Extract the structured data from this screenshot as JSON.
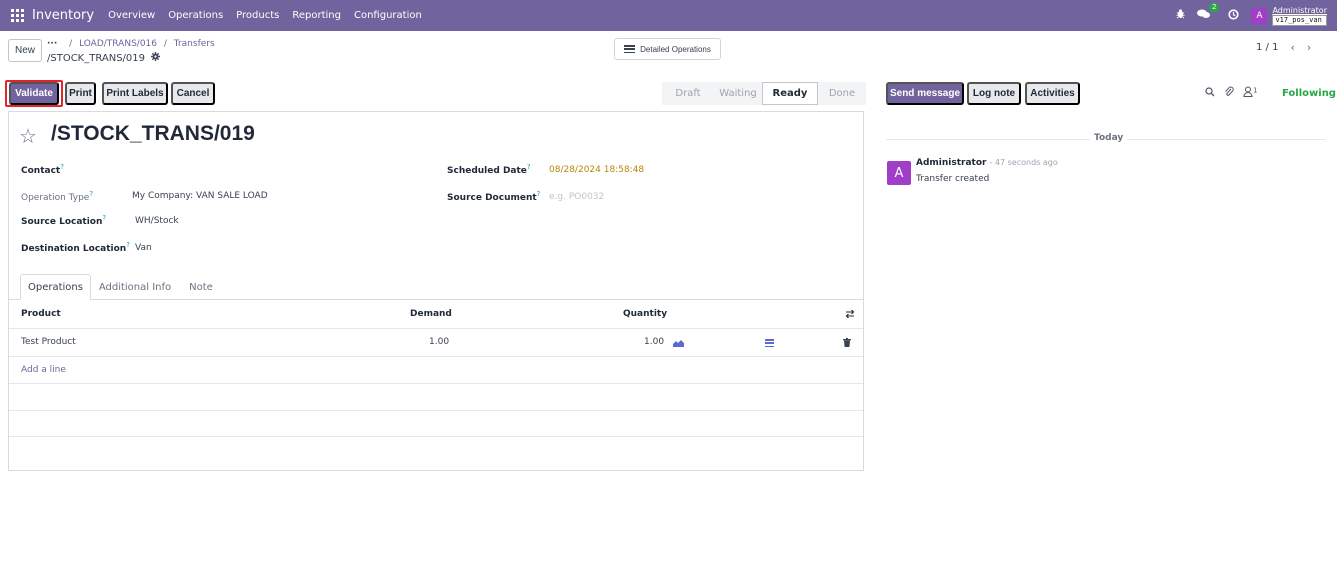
{
  "topbar": {
    "app_name": "Inventory",
    "menu": [
      "Overview",
      "Operations",
      "Products",
      "Reporting",
      "Configuration"
    ],
    "chat_badge": "2",
    "avatar_letter": "A",
    "user_name": "Administrator",
    "db_name": "v17_pos_van"
  },
  "control": {
    "new_label": "New",
    "breadcrumb_dots": "···",
    "breadcrumb": [
      "LOAD/TRANS/016",
      "Transfers"
    ],
    "breadcrumb_sep": "/",
    "record_name": "/STOCK_TRANS/019",
    "detailed_ops_label": "Detailed Operations",
    "pager": "1 / 1"
  },
  "buttons": {
    "validate": "Validate",
    "print": "Print",
    "print_labels": "Print Labels",
    "cancel": "Cancel"
  },
  "status": [
    "Draft",
    "Waiting",
    "Ready",
    "Done"
  ],
  "status_active": "Ready",
  "chatter": {
    "send_message": "Send message",
    "log_note": "Log note",
    "activities": "Activities",
    "followers_count": "1",
    "following": "Following",
    "today": "Today",
    "author": "Administrator",
    "time": "- 47 seconds ago",
    "message": "Transfer created",
    "avatar_letter": "A"
  },
  "form": {
    "title": "/STOCK_TRANS/019",
    "contact_label": "Contact",
    "operation_type_label": "Operation Type",
    "operation_type_value": "My Company: VAN SALE LOAD",
    "source_location_label": "Source Location",
    "source_location_value": "WH/Stock",
    "destination_location_label": "Destination Location",
    "destination_location_value": "Van",
    "scheduled_date_label": "Scheduled Date",
    "scheduled_date_value": "08/28/2024 18:58:48",
    "source_document_label": "Source Document",
    "source_document_placeholder": "e.g. PO0032",
    "help_mark": "?"
  },
  "tabs": [
    "Operations",
    "Additional Info",
    "Note"
  ],
  "table": {
    "headers": [
      "Product",
      "Demand",
      "Quantity"
    ],
    "rows": [
      {
        "product": "Test Product",
        "demand": "1.00",
        "quantity": "1.00"
      }
    ],
    "add_line": "Add a line"
  },
  "colors": {
    "brand": "#71639e",
    "following": "#28a745",
    "avatar": "#a13ec7",
    "highlight": "#e3242b"
  }
}
